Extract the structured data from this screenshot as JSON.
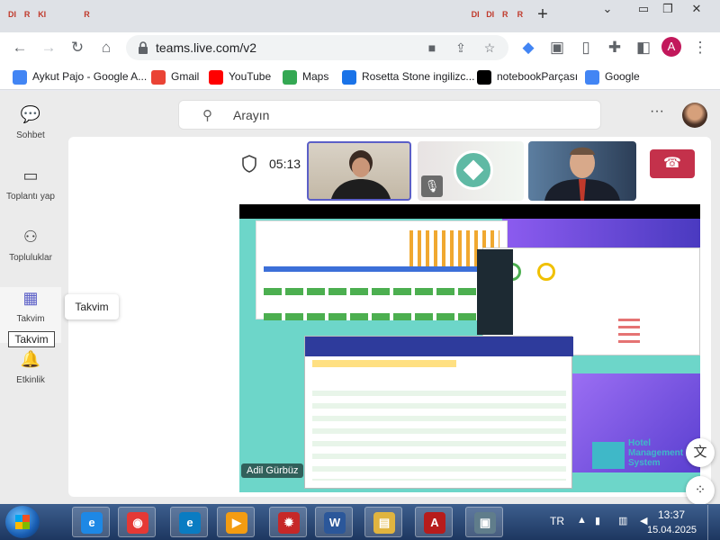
{
  "browser": {
    "tabs": [
      "DI",
      "R",
      "KI",
      "",
      "",
      "R",
      "",
      "",
      "",
      "",
      "",
      "",
      "",
      "",
      "",
      "",
      "",
      "",
      "",
      "",
      "",
      "",
      "",
      "",
      "",
      "",
      "",
      "",
      "",
      "",
      "",
      "DI",
      "DI",
      "R",
      "R"
    ],
    "new_tab_glyph": "+",
    "url": "teams.live.com/v2",
    "profile_initial": "A",
    "bookmarks": [
      {
        "label": "Aykut Pajo - Google A...",
        "icon": "bookmark-diamond-icon",
        "color": "#4285f4"
      },
      {
        "label": "Gmail",
        "icon": "gmail-icon",
        "color": "#ea4335"
      },
      {
        "label": "YouTube",
        "icon": "youtube-icon",
        "color": "#ff0000"
      },
      {
        "label": "Maps",
        "icon": "maps-pin-icon",
        "color": "#34a853"
      },
      {
        "label": "Rosetta Stone ingilizc...",
        "icon": "rosetta-icon",
        "color": "#1a73e8"
      },
      {
        "label": "notebookParçası",
        "icon": "notebook-icon",
        "color": "#000000"
      },
      {
        "label": "Google",
        "icon": "google-icon",
        "color": "#4285f4"
      }
    ]
  },
  "teams": {
    "rail": [
      {
        "label": "Sohbet",
        "icon": "chat-icon"
      },
      {
        "label": "Toplantı yap",
        "icon": "video-camera-icon"
      },
      {
        "label": "Topluluklar",
        "icon": "communities-icon"
      },
      {
        "label": "Takvim",
        "icon": "calendar-icon"
      },
      {
        "label": "Etkinlik",
        "icon": "bell-icon"
      }
    ],
    "tooltip": "Takvim",
    "focus_label": "Takvim",
    "search_placeholder": "Arayın",
    "meeting": {
      "timer": "05:13",
      "presenter": "Adil Gürbüz",
      "shared_app_logo": "Hotel Management System",
      "colors": {
        "leave": "#c4314b",
        "accent": "#5b5fc7"
      }
    }
  },
  "taskbar": {
    "language": "TR",
    "time": "13:37",
    "date": "15.04.2025",
    "apps": [
      "internet-explorer-icon",
      "chrome-icon",
      "edge-icon",
      "media-player-icon",
      "game-icon",
      "word-icon",
      "file-explorer-icon",
      "acrobat-icon",
      "computer-icon"
    ]
  }
}
